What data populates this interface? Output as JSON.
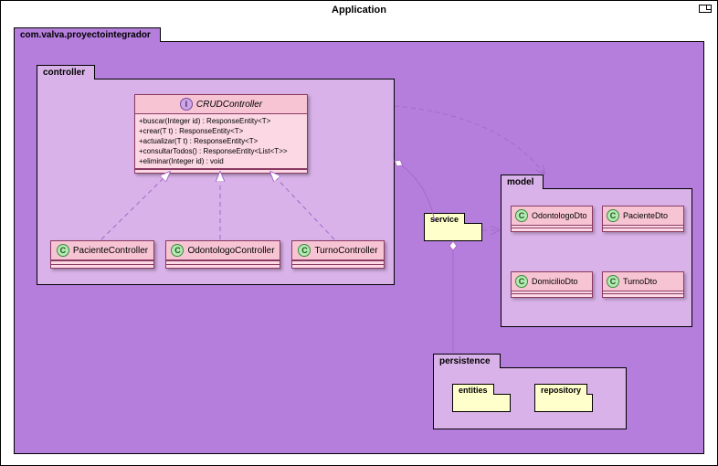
{
  "title": "Application",
  "rootPackage": "com.valva.proyectointegrador",
  "packages": {
    "controller": "controller",
    "model": "model",
    "persistence": "persistence",
    "service": "service",
    "entities": "entities",
    "repository": "repository"
  },
  "interface": {
    "name": "CRUDController",
    "ops": [
      "+buscar(Integer id) : ResponseEntity<T>",
      "+crear(T t) : ResponseEntity<T>",
      "+actualizar(T t) : ResponseEntity<T>",
      "+consultarTodos() : ResponseEntity<List<T>>",
      "+eliminar(Integer id) : void"
    ]
  },
  "controllers": [
    "PacienteController",
    "OdontologoController",
    "TurnoController"
  ],
  "dtos": [
    "OdontologoDto",
    "PacienteDto",
    "DomicilioDto",
    "TurnoDto"
  ]
}
